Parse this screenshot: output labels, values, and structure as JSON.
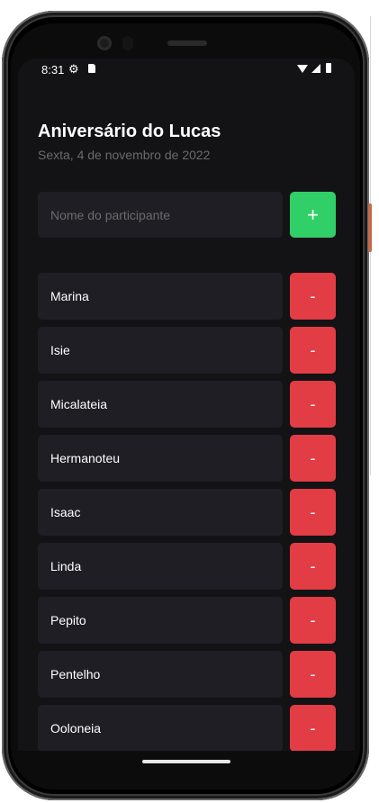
{
  "status_bar": {
    "time": "8:31"
  },
  "header": {
    "title": "Aniversário do Lucas",
    "subtitle": "Sexta, 4 de novembro de 2022"
  },
  "form": {
    "placeholder": "Nome do participante",
    "add_label": "+"
  },
  "participants": [
    {
      "name": "Marina",
      "remove_label": "-"
    },
    {
      "name": "Isie",
      "remove_label": "-"
    },
    {
      "name": "Micalateia",
      "remove_label": "-"
    },
    {
      "name": "Hermanoteu",
      "remove_label": "-"
    },
    {
      "name": "Isaac",
      "remove_label": "-"
    },
    {
      "name": "Linda",
      "remove_label": "-"
    },
    {
      "name": "Pepito",
      "remove_label": "-"
    },
    {
      "name": "Pentelho",
      "remove_label": "-"
    },
    {
      "name": "Ooloneia",
      "remove_label": "-"
    }
  ],
  "colors": {
    "background": "#131316",
    "field": "#1f1e25",
    "add": "#31cf67",
    "remove": "#e23c44"
  }
}
